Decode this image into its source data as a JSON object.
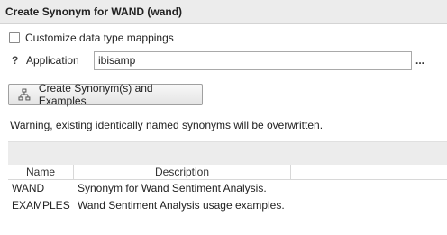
{
  "title": "Create Synonym for WAND (wand)",
  "options": {
    "customize_label": "Customize data type mappings",
    "customize_checked": false
  },
  "application": {
    "help_glyph": "?",
    "label": "Application",
    "value": "ibisamp",
    "browse_label": "..."
  },
  "create_button": {
    "label": "Create Synonym(s) and Examples",
    "icon": "hierarchy-icon"
  },
  "warning": "Warning, existing identically named synonyms will be overwritten.",
  "table": {
    "columns": [
      "Name",
      "Description"
    ],
    "rows": [
      {
        "name": "WAND",
        "description": "Synonym for Wand Sentiment Analysis."
      },
      {
        "name": "EXAMPLES",
        "description": "Wand Sentiment Analysis usage examples."
      }
    ]
  }
}
